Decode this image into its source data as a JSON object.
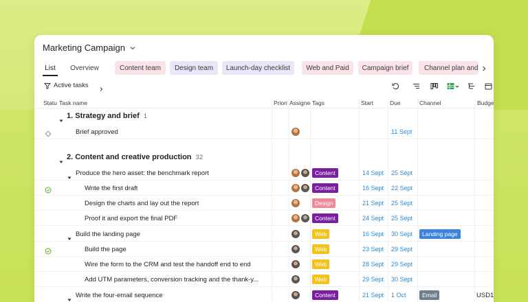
{
  "project": {
    "title": "Marketing Campaign"
  },
  "tabs": [
    {
      "label": "List"
    },
    {
      "label": "Overview"
    },
    {
      "label": "Content team"
    },
    {
      "label": "Design team"
    },
    {
      "label": "Launch-day checklist"
    },
    {
      "label": "Web and Paid"
    },
    {
      "label": "Campaign brief"
    },
    {
      "label": "Channel plan and"
    }
  ],
  "toolbar": {
    "filter_label": "Active tasks"
  },
  "columns": {
    "status": "Statu",
    "task": "Task name",
    "priority": "Priori",
    "assignee": "Assigne",
    "tags": "Tags",
    "start": "Start",
    "due": "Due",
    "channel": "Channel",
    "budget": "Budge"
  },
  "rows": [
    {
      "section": "1. Strategy and brief",
      "count": "1"
    },
    {
      "name": "Brief approved",
      "start": "",
      "due": "11 Sept",
      "tag": "",
      "channel": "",
      "budget": ""
    },
    {
      "section": "2. Content and creative production",
      "count": "32"
    },
    {
      "name": "Produce the hero asset: the benchmark report",
      "start": "14 Sept",
      "due": "25 Sept",
      "tag": "Content",
      "channel": "",
      "budget": ""
    },
    {
      "name": "Write the first draft",
      "start": "16 Sept",
      "due": "22 Sept",
      "tag": "Content",
      "channel": "",
      "budget": ""
    },
    {
      "name": "Design the charts and lay out the report",
      "start": "21 Sept",
      "due": "25 Sept",
      "tag": "Design",
      "channel": "",
      "budget": ""
    },
    {
      "name": "Proof it and export the final PDF",
      "start": "24 Sept",
      "due": "25 Sept",
      "tag": "Content",
      "channel": "",
      "budget": ""
    },
    {
      "name": "Build the landing page",
      "start": "16 Sept",
      "due": "30 Sept",
      "tag": "Web",
      "channel": "Landing page",
      "budget": ""
    },
    {
      "name": "Build the page",
      "start": "23 Sept",
      "due": "29 Sept",
      "tag": "Web",
      "channel": "",
      "budget": ""
    },
    {
      "name": "Wire the form to the CRM and test the handoff end to end",
      "start": "28 Sept",
      "due": "29 Sept",
      "tag": "Web",
      "channel": "",
      "budget": ""
    },
    {
      "name": "Add UTM parameters, conversion tracking and the thank-y...",
      "start": "29 Sept",
      "due": "30 Sept",
      "tag": "Web",
      "channel": "",
      "budget": ""
    },
    {
      "name": "Write the four-email sequence",
      "start": "21 Sept",
      "due": "1 Oct",
      "tag": "Content",
      "channel": "Email",
      "budget": "USD1,"
    }
  ],
  "colors": {
    "background": "#cfe568",
    "date": "#2b8bd8",
    "tag_content": "#7b1fa2",
    "tag_design": "#f08a96",
    "tag_web": "#f4c21b",
    "channel_landing": "#3d82de",
    "channel_email": "#6f7f91"
  }
}
